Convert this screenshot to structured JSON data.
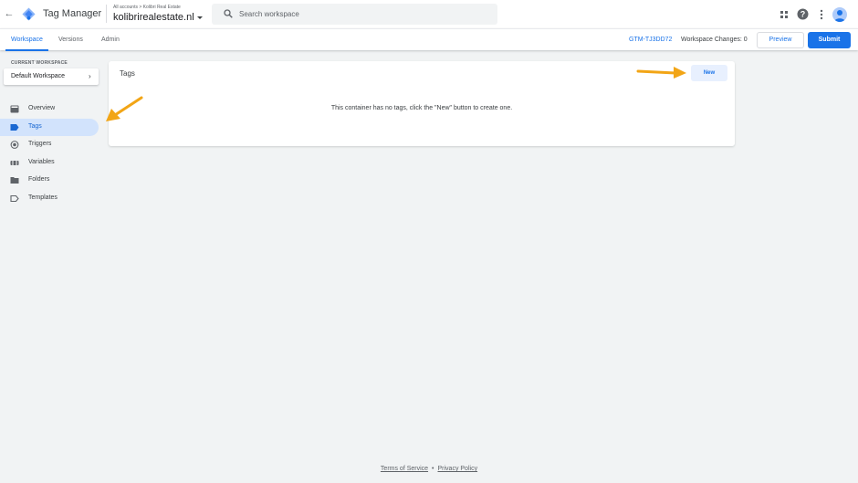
{
  "topbar": {
    "product_name": "Tag Manager",
    "breadcrumb": "All accounts > Kolibri Real Estate",
    "container_name": "kolibrirealestate.nl",
    "search_placeholder": "Search workspace",
    "icons": {
      "back": "arrow-back-icon",
      "logo": "tag-manager-logo",
      "apps": "apps-grid-icon",
      "help": "help-icon",
      "more": "more-vert-icon",
      "avatar": "account-avatar"
    }
  },
  "subbar": {
    "tabs": [
      {
        "label": "Workspace",
        "active": true
      },
      {
        "label": "Versions",
        "active": false
      },
      {
        "label": "Admin",
        "active": false
      }
    ],
    "container_id": "GTM-TJ3DD72",
    "workspace_changes": "Workspace Changes: 0",
    "preview_label": "Preview",
    "submit_label": "Submit"
  },
  "sidebar": {
    "workspace_heading": "CURRENT WORKSPACE",
    "workspace_name": "Default Workspace",
    "items": [
      {
        "label": "Overview",
        "icon": "overview-icon",
        "active": false
      },
      {
        "label": "Tags",
        "icon": "tag-icon",
        "active": true
      },
      {
        "label": "Triggers",
        "icon": "trigger-icon",
        "active": false
      },
      {
        "label": "Variables",
        "icon": "variables-icon",
        "active": false
      },
      {
        "label": "Folders",
        "icon": "folder-icon",
        "active": false
      },
      {
        "label": "Templates",
        "icon": "template-icon",
        "active": false
      }
    ]
  },
  "main": {
    "card_title": "Tags",
    "new_label": "New",
    "empty_message": "This container has no tags, click the \"New\" button to create one."
  },
  "footer": {
    "terms": "Terms of Service",
    "separator": "•",
    "privacy": "Privacy Policy"
  },
  "colors": {
    "accent": "#1a73e8",
    "active_nav_bg": "#d2e3fc",
    "annotation_arrow": "#f2a516",
    "page_bg": "#f1f3f4"
  }
}
